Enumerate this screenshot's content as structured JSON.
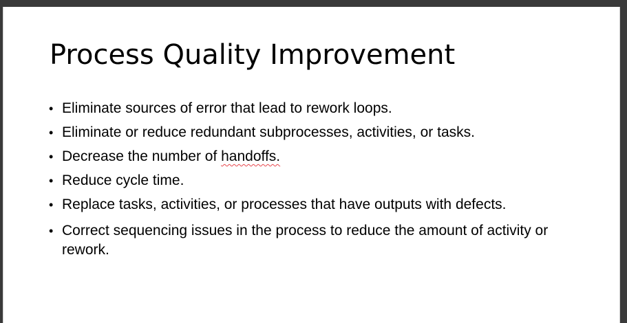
{
  "slide": {
    "title": "Process Quality Improvement",
    "bullet_glyph": "•",
    "bullets": [
      {
        "text": "Eliminate sources of error that lead to rework loops."
      },
      {
        "text": "Eliminate or reduce redundant subprocesses, activities, or tasks."
      },
      {
        "text_before": "Decrease the number of ",
        "flagged_word": "handoffs.",
        "text_after": ""
      },
      {
        "text": "Reduce cycle time."
      },
      {
        "text": "Replace tasks, activities, or processes that have outputs with defects."
      },
      {
        "text": "Correct sequencing issues in the process to reduce the amount of activity or rework."
      }
    ]
  },
  "colors": {
    "spellcheck_underline": "#e8454b",
    "window_frame": "#3a3a3a"
  }
}
